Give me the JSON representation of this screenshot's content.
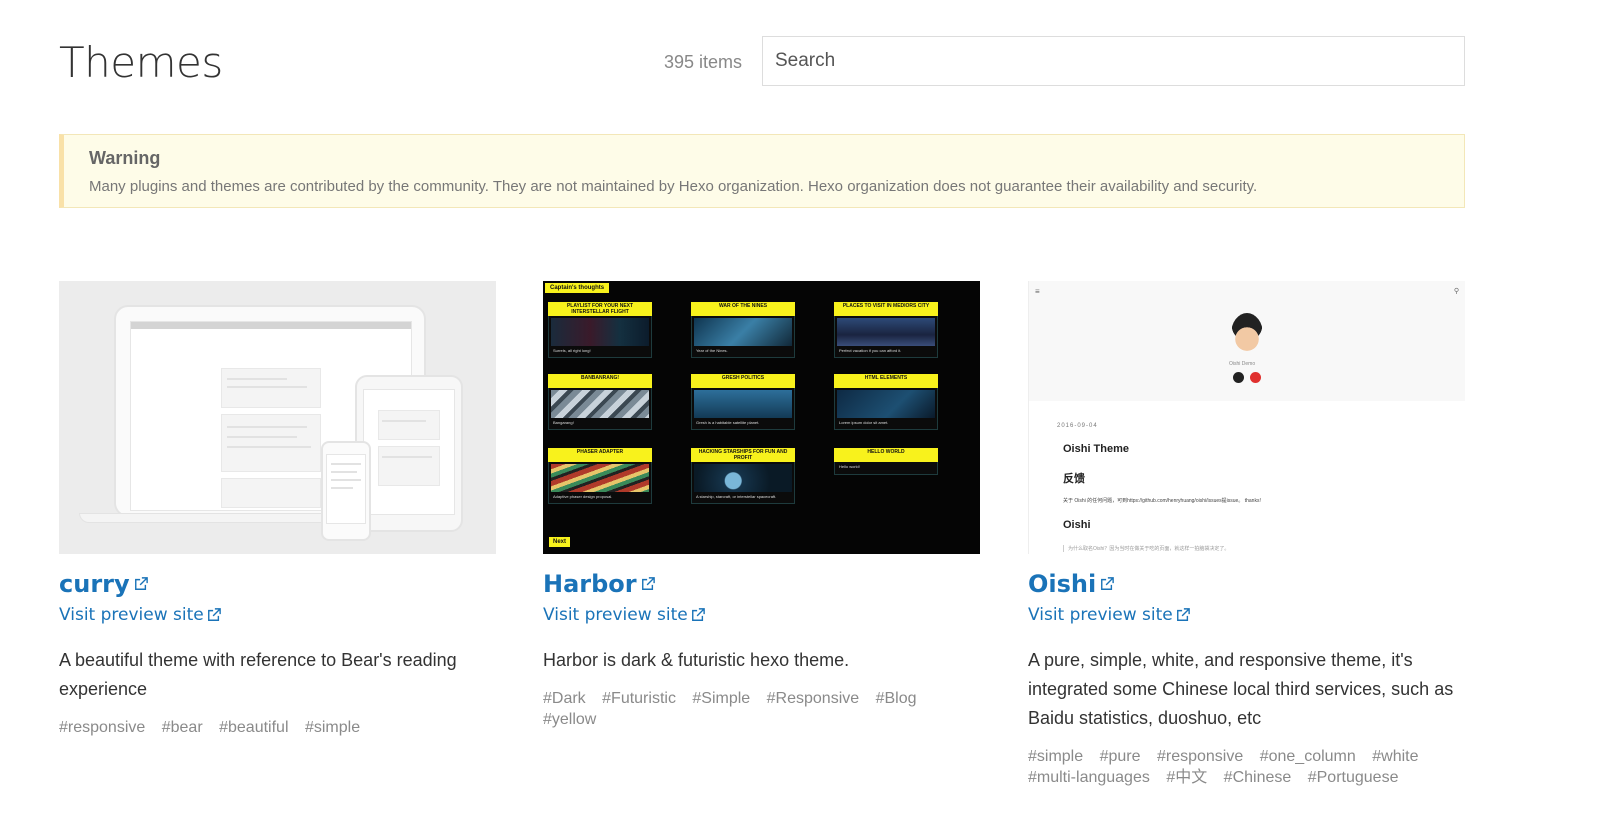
{
  "header": {
    "title": "Themes",
    "count": "395 items",
    "search_placeholder": "Search"
  },
  "warning": {
    "title": "Warning",
    "body": "Many plugins and themes are contributed by the community. They are not maintained by Hexo organization. Hexo organization does not guarantee their availability and security."
  },
  "cards": [
    {
      "name": "curry",
      "visit": "Visit preview site",
      "description": "A beautiful theme with reference to Bear's reading experience",
      "tags": [
        "#responsive",
        "#bear",
        "#beautiful",
        "#simple"
      ]
    },
    {
      "name": "Harbor",
      "visit": "Visit preview site",
      "description": "Harbor is dark & futuristic hexo theme.",
      "tags": [
        "#Dark",
        "#Futuristic",
        "#Simple",
        "#Responsive",
        "#Blog",
        "#yellow"
      ],
      "thumbnail": {
        "badge": "Captain's thoughts",
        "next": "Next",
        "posts": [
          {
            "title": "PLAYLIST FOR YOUR NEXT INTERSTELLAR FLIGHT",
            "text": "Surrels, all right long!"
          },
          {
            "title": "WAR OF THE NINES",
            "text": "Year of the Nines."
          },
          {
            "title": "PLACES TO VISIT IN MEDIORS CITY",
            "text": "Perfect vacation if you can afford it."
          },
          {
            "title": "BANBANRANG!",
            "text": "Bangarang!"
          },
          {
            "title": "GRESH POLITICS",
            "text": "Gresh is a habitable satellite planet."
          },
          {
            "title": "HTML ELEMENTS",
            "text": "Lorem ipsum dolor sit amet."
          },
          {
            "title": "PHASER ADAPTER",
            "text": "Adaptive phaser design proposal."
          },
          {
            "title": "HACKING STARSHIPS FOR FUN AND PROFIT",
            "text": "A starship, starcraft, or interstellar spacecraft."
          },
          {
            "title": "HELLO WORLD",
            "text": "Hello world!"
          }
        ]
      }
    },
    {
      "name": "Oishi",
      "visit": "Visit preview site",
      "description": "A pure, simple, white, and responsive theme, it's integrated some Chinese local third services, such as Baidu statistics, duoshuo, etc",
      "tags": [
        "#simple",
        "#pure",
        "#responsive",
        "#one_column",
        "#white",
        "#multi-languages",
        "#中文",
        "#Chinese",
        "#Portuguese"
      ],
      "thumbnail": {
        "author": "Oishi Demo",
        "date": "2016-09-04",
        "post_title": "Oishi Theme",
        "section1": "反馈",
        "text1": "关于 Oishi 的任何问题，可到https://github.com/henryhuang/oishi/issues提issue。 thanks!",
        "section2": "Oishi",
        "text2": "为什么取名Oishi？因为当时在做关于吃的页面，就这样一拍脑袋决定了。"
      }
    }
  ],
  "colors": {
    "link": "#1a73b8",
    "tag": "#8a8a8a",
    "warning_bg": "#fefce8",
    "harbor_yellow": "#f8f21c"
  }
}
